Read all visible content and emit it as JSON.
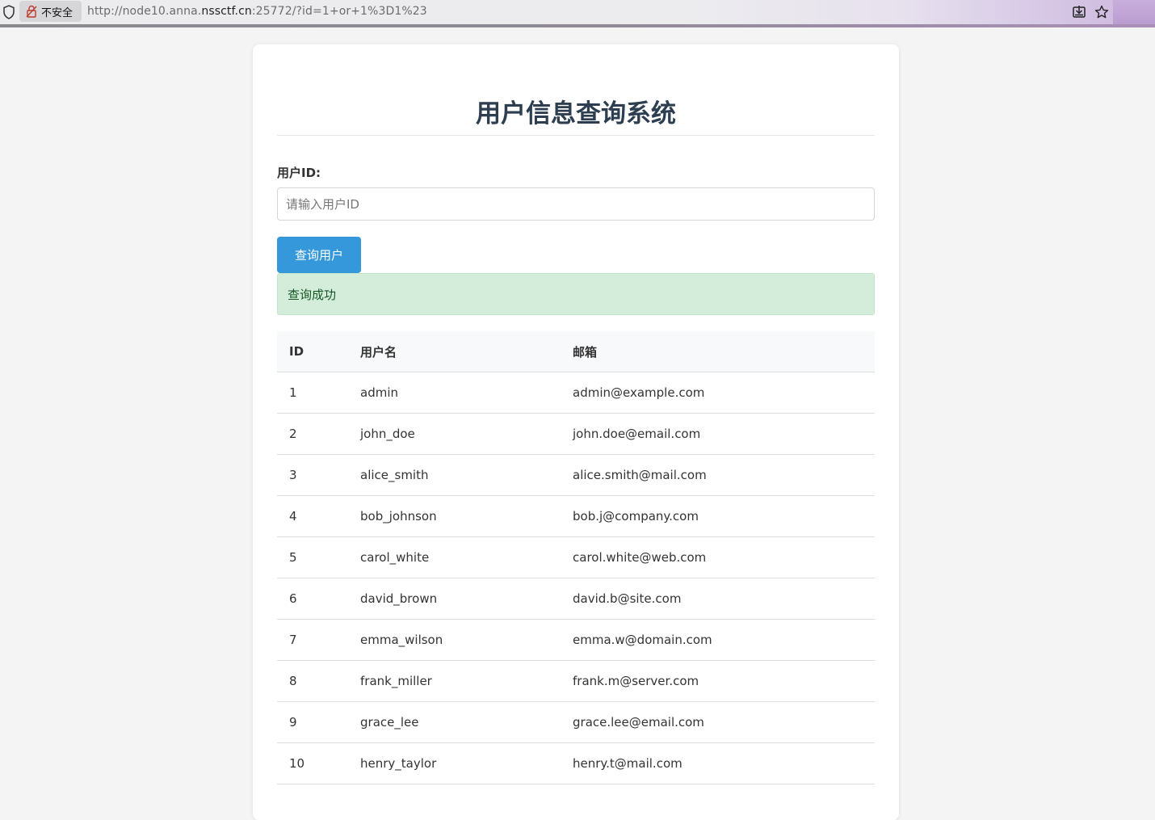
{
  "browser": {
    "security_label": "不安全",
    "url_prefix": "http://node10.anna.",
    "url_host": "nssctf.cn",
    "url_suffix": ":25772/?id=1+or+1%3D1%23"
  },
  "page": {
    "title": "用户信息查询系统",
    "field_label": "用户ID:",
    "input_placeholder": "请输入用户ID",
    "input_value": "",
    "button_label": "查询用户",
    "status_message": "查询成功",
    "status_color": "#d4edda",
    "accent_color": "#3498db"
  },
  "table": {
    "headers": [
      "ID",
      "用户名",
      "邮箱"
    ],
    "rows": [
      {
        "id": "1",
        "username": "admin",
        "email": "admin@example.com"
      },
      {
        "id": "2",
        "username": "john_doe",
        "email": "john.doe@email.com"
      },
      {
        "id": "3",
        "username": "alice_smith",
        "email": "alice.smith@mail.com"
      },
      {
        "id": "4",
        "username": "bob_johnson",
        "email": "bob.j@company.com"
      },
      {
        "id": "5",
        "username": "carol_white",
        "email": "carol.white@web.com"
      },
      {
        "id": "6",
        "username": "david_brown",
        "email": "david.b@site.com"
      },
      {
        "id": "7",
        "username": "emma_wilson",
        "email": "emma.w@domain.com"
      },
      {
        "id": "8",
        "username": "frank_miller",
        "email": "frank.m@server.com"
      },
      {
        "id": "9",
        "username": "grace_lee",
        "email": "grace.lee@email.com"
      },
      {
        "id": "10",
        "username": "henry_taylor",
        "email": "henry.t@mail.com"
      }
    ]
  }
}
